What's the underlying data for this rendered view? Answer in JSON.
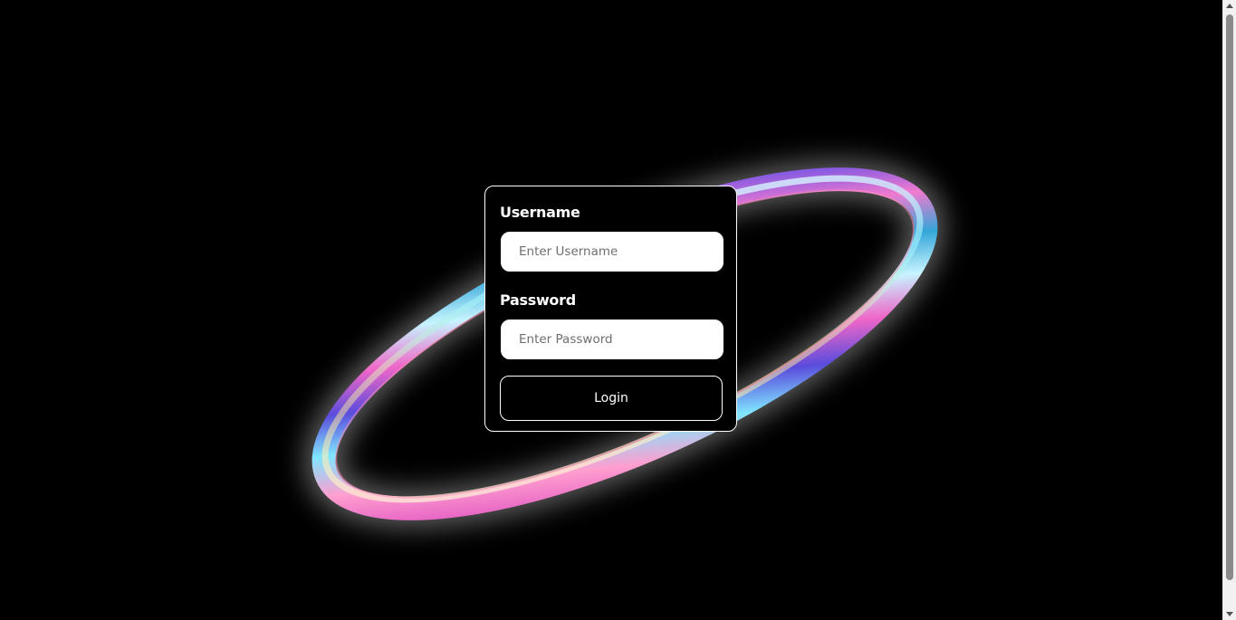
{
  "login_form": {
    "username_label": "Username",
    "username_placeholder": "Enter Username",
    "username_value": "",
    "password_label": "Password",
    "password_placeholder": "Enter Password",
    "password_value": "",
    "login_button_label": "Login"
  },
  "background": {
    "color": "#000000",
    "decoration": "iridescent-ring"
  },
  "colors": {
    "card_border": "#ffffff",
    "input_background": "#ffffff",
    "button_background": "#000000",
    "text": "#ffffff"
  }
}
